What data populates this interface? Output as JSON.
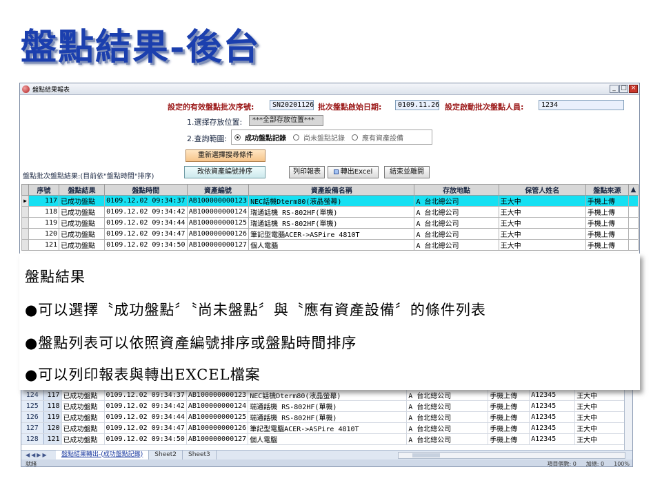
{
  "slide": {
    "title": "盤點結果-後台"
  },
  "excel": {
    "rows": [
      {
        "row": "124",
        "seq": "117",
        "result": "已成功盤點",
        "time": "0109.12.02 09:34:37",
        "code": "AB100000000123",
        "name": "NEC話機Dterm80(液晶螢幕)",
        "location": "A 台北總公司",
        "source": "手機上傳",
        "emp_id": "A12345",
        "keeper": "王大中"
      },
      {
        "row": "125",
        "seq": "118",
        "result": "已成功盤點",
        "time": "0109.12.02 09:34:42",
        "code": "AB100000000124",
        "name": "瑞通話機 RS-802HF(單機)",
        "location": "A 台北總公司",
        "source": "手機上傳",
        "emp_id": "A12345",
        "keeper": "王大中"
      },
      {
        "row": "126",
        "seq": "119",
        "result": "已成功盤點",
        "time": "0109.12.02 09:34:44",
        "code": "AB100000000125",
        "name": "瑞通話機 RS-802HF(單機)",
        "location": "A 台北總公司",
        "source": "手機上傳",
        "emp_id": "A12345",
        "keeper": "王大中"
      },
      {
        "row": "127",
        "seq": "120",
        "result": "已成功盤點",
        "time": "0109.12.02 09:34:47",
        "code": "AB100000000126",
        "name": "筆記型電腦ACER->ASPire 4810T",
        "location": "A 台北總公司",
        "source": "手機上傳",
        "emp_id": "A12345",
        "keeper": "王大中"
      },
      {
        "row": "128",
        "seq": "121",
        "result": "已成功盤點",
        "time": "0109.12.02 09:34:50",
        "code": "AB100000000127",
        "name": "個人電腦",
        "location": "A 台北總公司",
        "source": "手機上傳",
        "emp_id": "A12345",
        "keeper": "王大中"
      }
    ],
    "sheets": [
      "盤點結果轉出-(成功盤點記錄)",
      "Sheet2",
      "Sheet3"
    ],
    "status": {
      "ready": "就緒",
      "count": "項目個數: 0",
      "sum": "加總: 0",
      "zoom": "100%"
    }
  },
  "form": {
    "window_title": "盤點結果報表",
    "batch_label": "設定的有效盤點批次序號:",
    "batch_value": "SN20201126",
    "start_label": "批次盤點啟始日期:",
    "start_value": "0109.11.26",
    "user_label": "設定啟動批次盤點人員:",
    "user_value": "1234",
    "location_label": "1.選擇存放位置:",
    "location_value": "***全部存放位置***",
    "range_label": "2.查詢範圍:",
    "range_options": [
      "成功盤點記錄",
      "尚未盤點記錄",
      "應有資產設備"
    ],
    "btn_reselect": "重新選擇搜尋條件",
    "list_label": "盤點批次盤點結果:(目前依\"盤點時間\"排序)",
    "btn_sort": "改依資產編號排序",
    "btn_print": "列印報表",
    "btn_export": "轉出Excel",
    "btn_close": "結束並離開",
    "columns": [
      "序號",
      "盤點結果",
      "盤點時間",
      "資產編號",
      "資產設備名稱",
      "存放地點",
      "保管人姓名",
      "盤點來源"
    ],
    "rows": [
      {
        "seq": "117",
        "result": "已成功盤點",
        "time": "0109.12.02 09:34:37",
        "code": "AB100000000123",
        "name": "NEC話機Dterm80(液晶螢幕)",
        "location": "A 台北總公司",
        "keeper": "王大中",
        "source": "手機上傳"
      },
      {
        "seq": "118",
        "result": "已成功盤點",
        "time": "0109.12.02 09:34:42",
        "code": "AB100000000124",
        "name": "瑞通話機 RS-802HF(單機)",
        "location": "A 台北總公司",
        "keeper": "王大中",
        "source": "手機上傳"
      },
      {
        "seq": "119",
        "result": "已成功盤點",
        "time": "0109.12.02 09:34:44",
        "code": "AB100000000125",
        "name": "瑞通話機 RS-802HF(單機)",
        "location": "A 台北總公司",
        "keeper": "王大中",
        "source": "手機上傳"
      },
      {
        "seq": "120",
        "result": "已成功盤點",
        "time": "0109.12.02 09:34:47",
        "code": "AB100000000126",
        "name": "筆記型電腦ACER->ASPire 4810T",
        "location": "A 台北總公司",
        "keeper": "王大中",
        "source": "手機上傳"
      },
      {
        "seq": "121",
        "result": "已成功盤點",
        "time": "0109.12.02 09:34:50",
        "code": "AB100000000127",
        "name": "個人電腦",
        "location": "A 台北總公司",
        "keeper": "王大中",
        "source": "手機上傳"
      }
    ]
  },
  "caption": {
    "heading": "盤點結果",
    "bullets": [
      "●可以選擇〝成功盤點〞〝尚未盤點〞與〝應有資產設備〞的條件列表",
      "●盤點列表可以依照資產編號排序或盤點時間排序",
      "●可以列印報表與轉出EXCEL檔案"
    ]
  }
}
